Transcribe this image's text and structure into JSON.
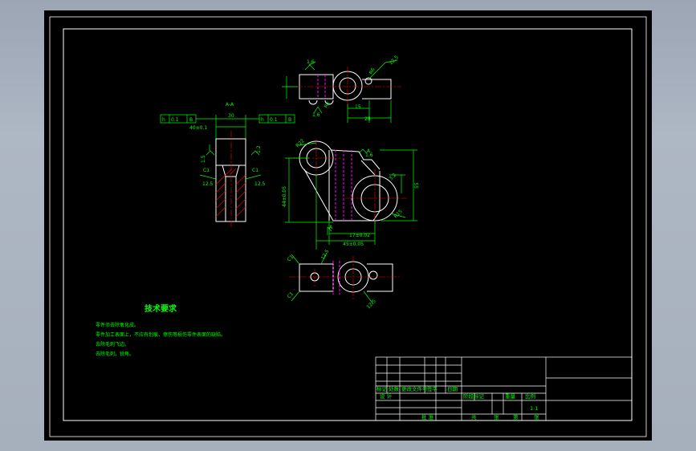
{
  "tech_requirements": {
    "title": "技术要求",
    "items": [
      "零件须去除氧化皮。",
      "零件加工表面上，不应有划痕、擦伤等损伤零件表面的缺陷。",
      "去除毛刺飞边。",
      "去除毛刺，锐角。"
    ]
  },
  "dimensions": {
    "d1": "1.6",
    "d2": "12.5",
    "d3": "R6",
    "d4": "15",
    "d5": "R3",
    "d6": "28",
    "d7": "1.6",
    "d8": "30",
    "d9": "40±0.1",
    "d10": "C1",
    "d11": "12.5",
    "d12": "C1",
    "d13": "12.5",
    "d14": "R22",
    "d15": "55",
    "d16": "3.2",
    "d17": "R15",
    "d18": "17±0.02",
    "d19": "45±0.05",
    "d20": "C1",
    "d21": "12.5",
    "d22": "C1",
    "d23": "12.5",
    "d24": "44±0.05",
    "d25": "A",
    "d26": "A",
    "d27": "1.5",
    "d28": "1.2",
    "d29": "A-A",
    "d30": "1.6"
  },
  "gdt": {
    "left_frame": [
      "h",
      "0.1",
      "B"
    ],
    "right_frame": [
      "h",
      "0.1",
      "B"
    ]
  },
  "title_block": {
    "row_labels": [
      "标记",
      "处数",
      "更改文件号",
      "签字",
      "日期"
    ],
    "design_label": "设 计",
    "stage_labels": [
      "阶段标记",
      "重量",
      "比例"
    ],
    "scale": "1:1",
    "approve_label": "批 准",
    "sheet_labels": [
      "共",
      "张",
      "第",
      "张"
    ]
  },
  "colors": {
    "paper": "#000000",
    "frame": "#ffffff",
    "dimension": "#00ff00",
    "centerline": "#ff0000",
    "hidden": "#ff00ff",
    "object": "#ffffff"
  }
}
